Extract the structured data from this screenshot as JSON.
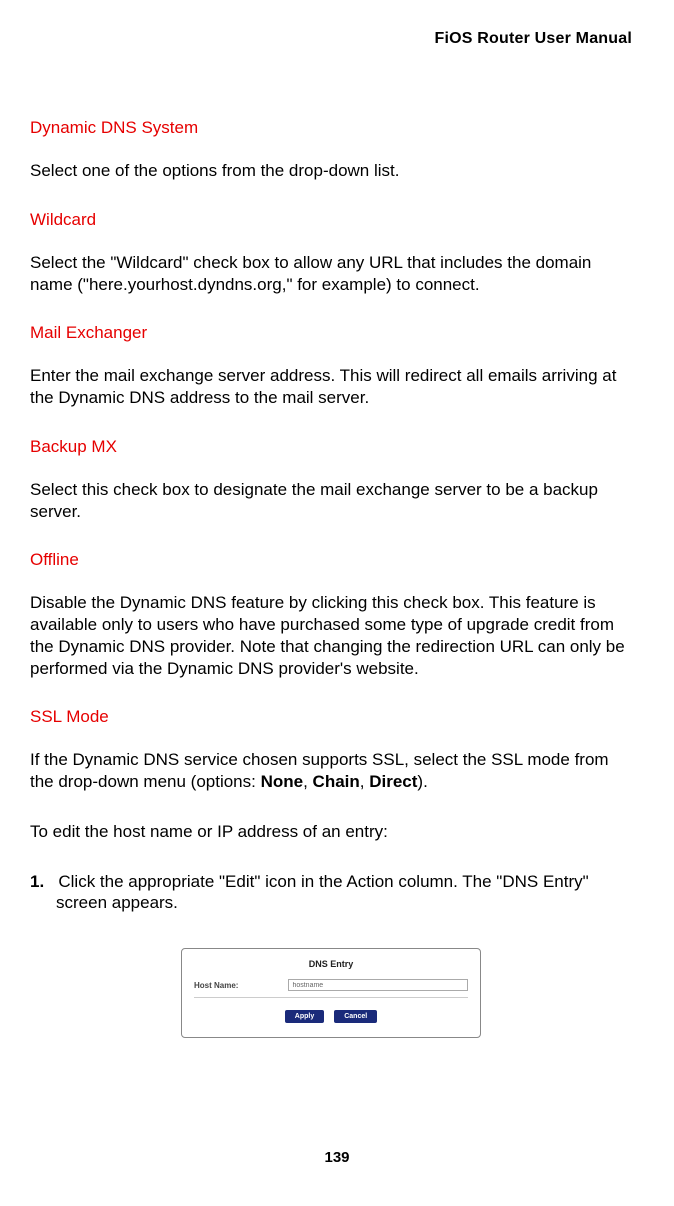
{
  "header": {
    "title": "FiOS Router User Manual"
  },
  "sections": {
    "dynamic_dns": {
      "heading": "Dynamic DNS System",
      "para": "Select one of the options from the drop-down list."
    },
    "wildcard": {
      "heading": "Wildcard",
      "para": "Select the \"Wildcard\" check box to allow any URL that includes the domain name (\"here.yourhost.dyndns.org,\" for example) to connect."
    },
    "mail_exchanger": {
      "heading": "Mail Exchanger",
      "para": "Enter the mail exchange server address. This will redirect all emails arriving at the Dynamic DNS address to the mail server."
    },
    "backup_mx": {
      "heading": "Backup MX",
      "para": "Select this check box to designate the mail exchange server to be a backup server."
    },
    "offline": {
      "heading": "Offline",
      "para": "Disable the Dynamic DNS feature by clicking this check box. This feature is available only to users who have purchased some type of upgrade credit from the Dynamic DNS provider. Note that changing the redirection URL can only be performed via the Dynamic DNS provider's website."
    },
    "ssl_mode": {
      "heading": "SSL Mode",
      "para_prefix": "If the Dynamic DNS service chosen supports SSL, select the SSL mode from the drop-down menu (options: ",
      "opt1": "None",
      "opt2": "Chain",
      "opt3": "Direct",
      "para_suffix": ").",
      "edit_intro": "To edit the host name or IP address of an entry:",
      "list_num": "1.",
      "list_text": "Click the appropriate \"Edit\" icon in the Action column. The \"DNS Entry\" screen appears."
    }
  },
  "dns_figure": {
    "title": "DNS Entry",
    "host_label": "Host Name:",
    "host_value": "hostname",
    "apply_label": "Apply",
    "cancel_label": "Cancel"
  },
  "page_number": "139"
}
